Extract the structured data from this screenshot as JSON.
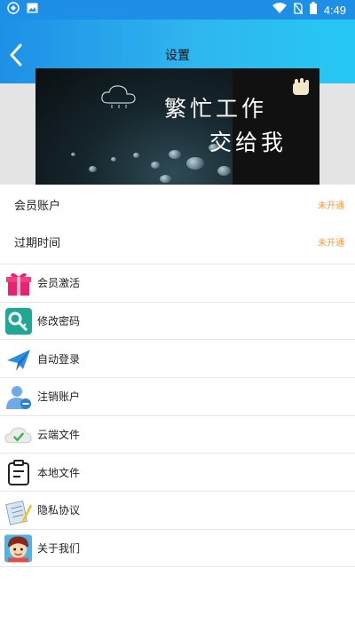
{
  "status_bar": {
    "time": "4:49",
    "icons": [
      "app-logo-icon",
      "image-icon",
      "wifi-icon",
      "no-sim-icon",
      "battery-icon"
    ]
  },
  "header": {
    "title": "设置",
    "back_icon": "chevron-left-icon",
    "gradient": [
      "#1e8fe6",
      "#26c8f3"
    ]
  },
  "banner": {
    "line1": "繁忙工作",
    "line2": "交给我"
  },
  "account": {
    "member_label": "会员账户",
    "member_value": "未开通",
    "expire_label": "过期时间",
    "expire_value": "未开通",
    "value_color": "#f29b3f"
  },
  "menu": [
    {
      "label": "会员激活",
      "icon": "gift-icon"
    },
    {
      "label": "修改密码",
      "icon": "key-icon"
    },
    {
      "label": "自动登录",
      "icon": "paper-plane-icon"
    },
    {
      "label": "注销账户",
      "icon": "user-remove-icon"
    },
    {
      "label": "云端文件",
      "icon": "cloud-check-icon"
    },
    {
      "label": "本地文件",
      "icon": "clipboard-icon"
    },
    {
      "label": "隐私协议",
      "icon": "notepad-icon"
    },
    {
      "label": "关于我们",
      "icon": "avatar-icon"
    }
  ]
}
